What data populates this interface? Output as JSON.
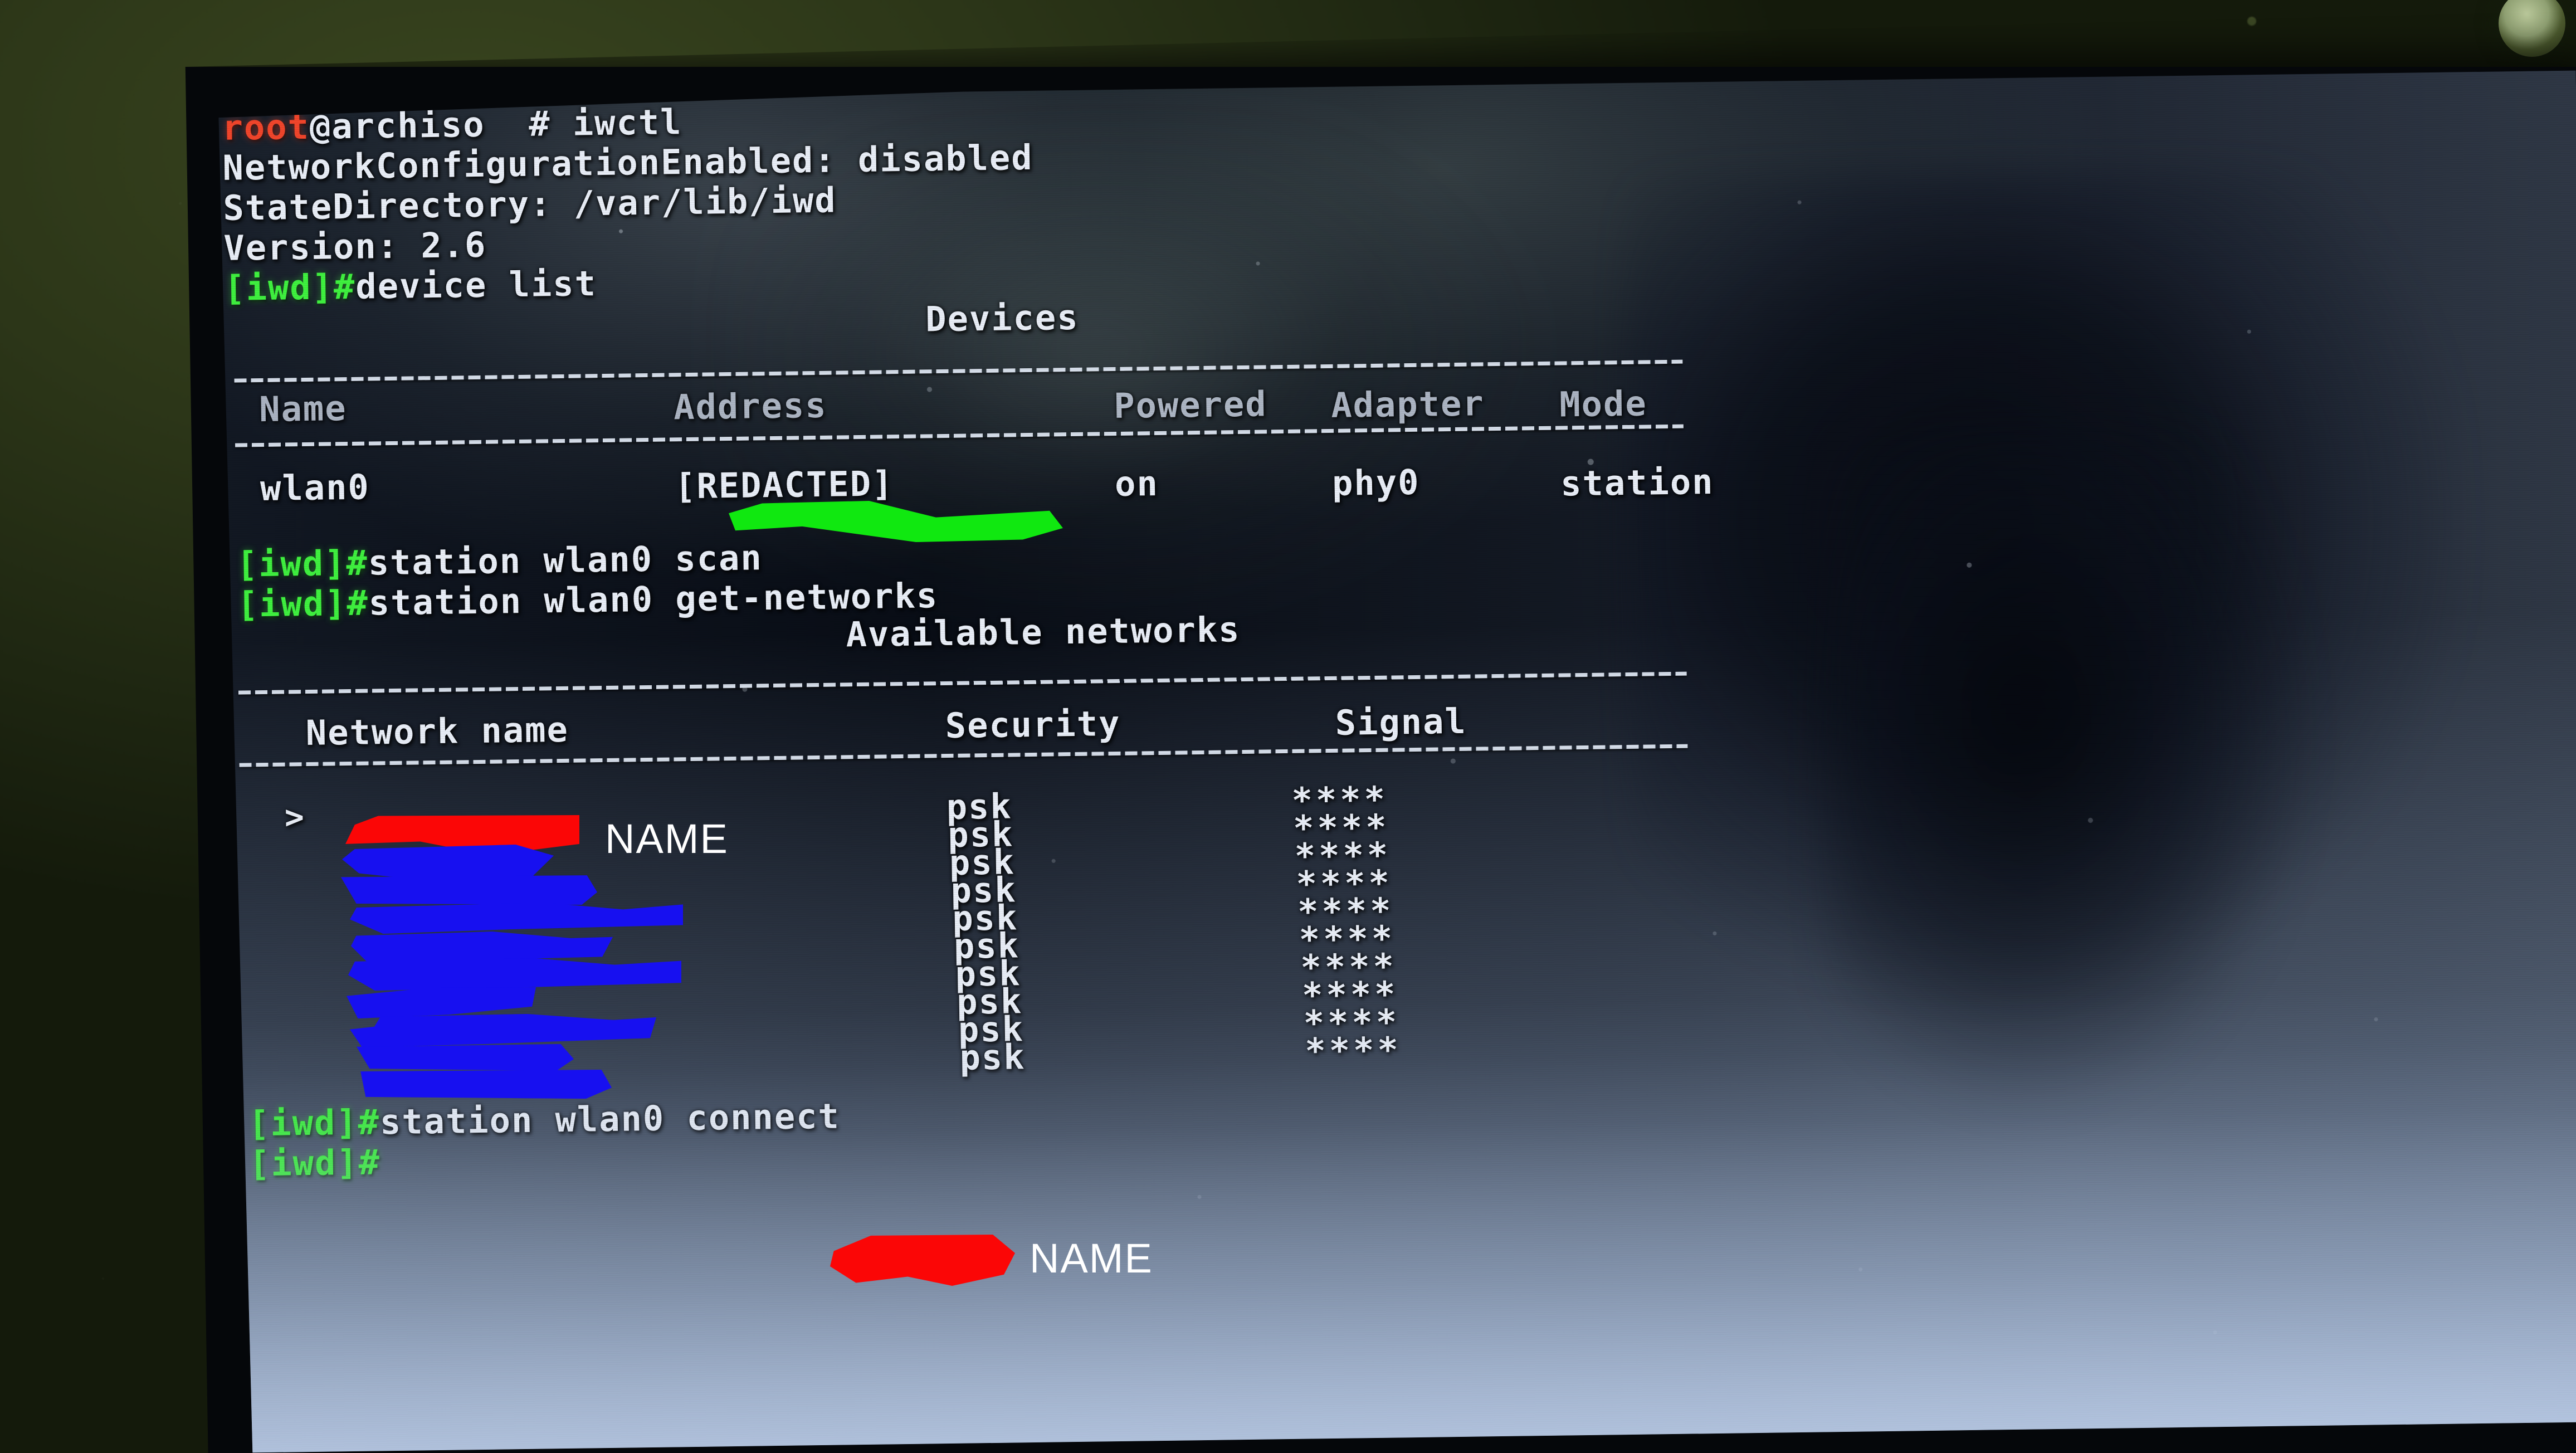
{
  "scene": {
    "description": "photo-of-laptop-screen",
    "background_color": "#2c3618",
    "bezel_color": "#05070a",
    "screen_base_color": "#060a12"
  },
  "terminal": {
    "prompt_user": "root",
    "prompt_host": "@archiso",
    "prompt_symbol": "#",
    "iwd_prompt": "[iwd]#",
    "colors": {
      "root": "#f0452b",
      "iwd_prompt": "#3ff03f",
      "text": "#e8edf6"
    },
    "lines": [
      {
        "kind": "shell-prompt",
        "user": "root",
        "host": "@archiso",
        "symbol": "#",
        "command": "iwctl"
      },
      {
        "kind": "output",
        "text": "NetworkConfigurationEnabled: disabled"
      },
      {
        "kind": "output",
        "text": "StateDirectory: /var/lib/iwd"
      },
      {
        "kind": "output",
        "text": "Version: 2.6"
      },
      {
        "kind": "iwd-prompt",
        "prompt": "[iwd]#",
        "command": "device list"
      }
    ]
  },
  "devices_table": {
    "title": "Devices",
    "headers": [
      "Name",
      "Address",
      "Powered",
      "Adapter",
      "Mode"
    ],
    "rows": [
      {
        "name": "wlan0",
        "address": "[REDACTED]",
        "address_redacted": true,
        "powered": "on",
        "adapter": "phy0",
        "mode": "station"
      }
    ]
  },
  "scan_commands": [
    {
      "prompt": "[iwd]#",
      "command": "station wlan0 scan"
    },
    {
      "prompt": "[iwd]#",
      "command": "station wlan0 get-networks"
    }
  ],
  "networks_table": {
    "title": "Available networks",
    "headers": [
      "Network name",
      "Security",
      "Signal"
    ],
    "rows": [
      {
        "marker": ">",
        "name": "[REDACTED]",
        "name_redacted": true,
        "redaction_color": "#fb0606",
        "annotation": "NAME",
        "security": "psk",
        "signal": "****"
      },
      {
        "marker": "",
        "name": "[REDACTED]",
        "name_redacted": true,
        "redaction_color": "#1710f0",
        "annotation": "",
        "security": "psk",
        "signal": "****"
      },
      {
        "marker": "",
        "name": "[REDACTED]",
        "name_redacted": true,
        "redaction_color": "#1710f0",
        "annotation": "",
        "security": "psk",
        "signal": "****"
      },
      {
        "marker": "",
        "name": "[REDACTED]",
        "name_redacted": true,
        "redaction_color": "#1710f0",
        "annotation": "",
        "security": "psk",
        "signal": "****"
      },
      {
        "marker": "",
        "name": "[REDACTED]",
        "name_redacted": true,
        "redaction_color": "#1710f0",
        "annotation": "",
        "security": "psk",
        "signal": "****"
      },
      {
        "marker": "",
        "name": "[REDACTED]",
        "name_redacted": true,
        "redaction_color": "#1710f0",
        "annotation": "",
        "security": "psk",
        "signal": "****"
      },
      {
        "marker": "",
        "name": "[REDACTED]",
        "name_redacted": true,
        "redaction_color": "#1710f0",
        "annotation": "",
        "security": "psk",
        "signal": "****"
      },
      {
        "marker": "",
        "name": "[REDACTED]",
        "name_redacted": true,
        "redaction_color": "#1710f0",
        "annotation": "",
        "security": "psk",
        "signal": "****"
      },
      {
        "marker": "",
        "name": "[REDACTED]",
        "name_redacted": true,
        "redaction_color": "#1710f0",
        "annotation": "",
        "security": "psk",
        "signal": "****"
      },
      {
        "marker": "",
        "name": "[REDACTED]",
        "name_redacted": true,
        "redaction_color": "#1710f0",
        "annotation": "",
        "security": "psk",
        "signal": "****"
      }
    ]
  },
  "connect_command": {
    "prompt": "[iwd]#",
    "command_prefix": "station wlan0 connect",
    "ssid": "[REDACTED]",
    "ssid_redacted": true,
    "annotation": "NAME"
  },
  "final_prompt": {
    "prompt": "[iwd]#",
    "command": ""
  },
  "annotations": {
    "name_label": "NAME",
    "redaction_red": "#fb0606",
    "redaction_blue": "#1710f0",
    "redaction_green": "#10e810"
  }
}
